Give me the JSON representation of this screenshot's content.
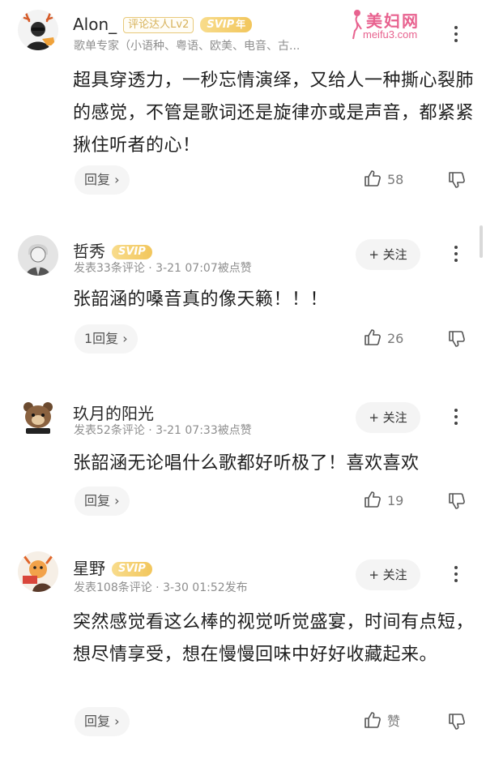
{
  "watermark": {
    "title": "美妇网",
    "url": "meifu3.com"
  },
  "comments": [
    {
      "user": "Alon_",
      "level_badge": "评论达人Lv2",
      "svip_badge": "SVIP",
      "svip_sub": "年",
      "meta": "歌单专家（小语种、粤语、欧美、电音、古...",
      "follow_label": "",
      "text": "超具穿透力，一秒忘情演绎，又给人一种撕心裂肺的感觉，不管是歌词还是旋律亦或是声音，都紧紧揪住听者的心！",
      "reply_label": "回复 ›",
      "likes": "58"
    },
    {
      "user": "哲秀",
      "svip_badge": "SVIP",
      "meta": "发表33条评论 · 3-21 07:07被点赞",
      "follow_label": "+ 关注",
      "text": "张韶涵的嗓音真的像天籁！！！",
      "reply_label": "1回复 ›",
      "likes": "26"
    },
    {
      "user": "玖月的阳光",
      "meta": "发表52条评论 · 3-21 07:33被点赞",
      "follow_label": "+ 关注",
      "text": "张韶涵无论唱什么歌都好听极了！喜欢喜欢",
      "reply_label": "回复 ›",
      "likes": "19"
    },
    {
      "user": "星野",
      "svip_badge": "SVIP",
      "meta": "发表108条评论 · 3-30 01:52发布",
      "follow_label": "+ 关注",
      "text": "突然感觉看这么棒的视觉听觉盛宴，时间有点短，想尽情享受，想在慢慢回味中好好收藏起来。",
      "reply_label": "回复 ›",
      "likes": "赞"
    }
  ],
  "icons": {
    "like": "thumbs-up-outline",
    "dislike": "thumbs-down-outline",
    "more": "vertical-ellipsis"
  },
  "colors": {
    "svip_gold": "#f2c65c",
    "level_border": "#e8c97a",
    "watermark_pink": "#e8628f",
    "meta_gray": "#8e8e8e",
    "pill_bg": "#f5f5f5"
  }
}
